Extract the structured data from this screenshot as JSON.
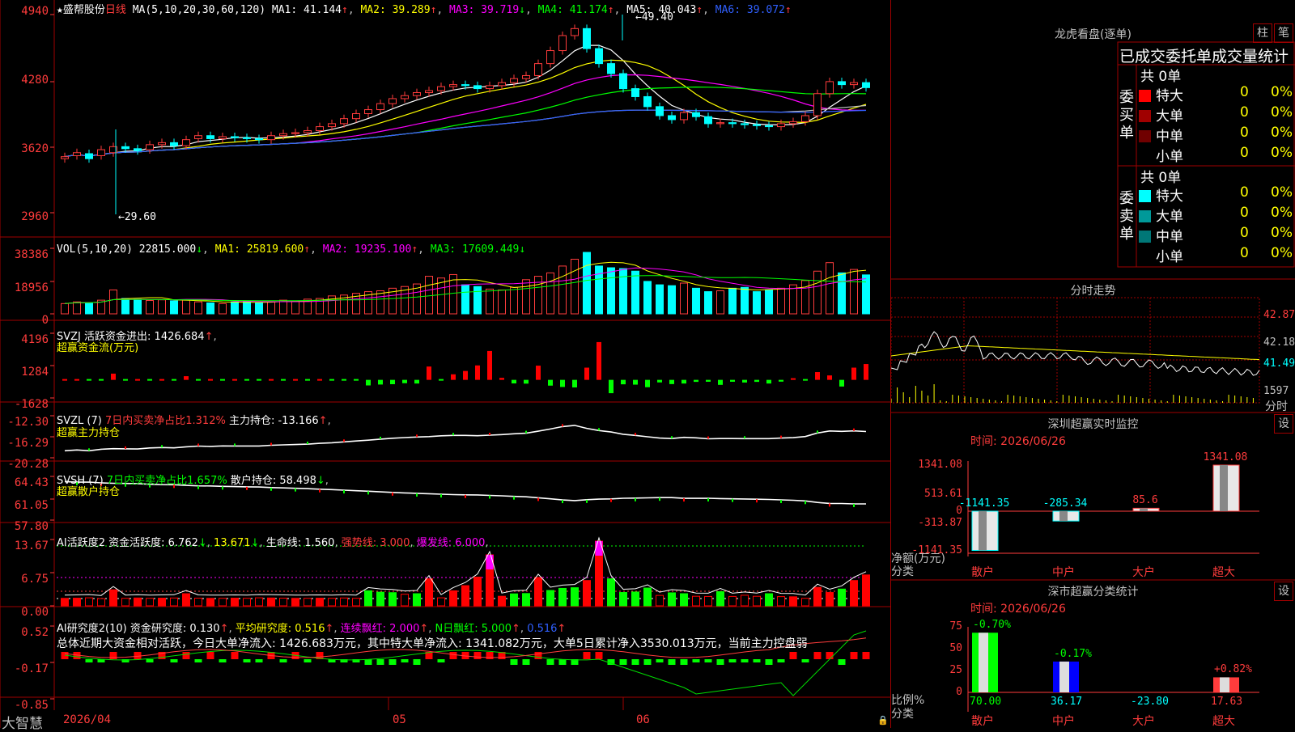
{
  "stock": {
    "name": "盛帮股份",
    "period": "日线",
    "ma_label": "MA(5,10,20,30,60,120)",
    "ma1": "MA1: 41.144",
    "ma2": "MA2: 39.289",
    "ma3": "MA3: 39.719",
    "ma4": "MA4: 41.174",
    "ma5": "MA5: 40.043",
    "ma6": "MA6: 39.072",
    "high_mark": "49.40",
    "low_mark": "29.60",
    "price_axis": [
      "4940",
      "4280",
      "3620",
      "2960"
    ]
  },
  "vol": {
    "label": "VOL(5,10,20)",
    "value": "22815.000",
    "ma1": "MA1: 25819.600",
    "ma2": "MA2: 19235.100",
    "ma3": "MA3: 17609.449",
    "axis": [
      "38386",
      "18956",
      "0"
    ]
  },
  "svzj": {
    "label": "SVZJ",
    "text": "活跃资金进出: 1426.684",
    "sub": "超赢资金流(万元)",
    "axis": [
      "4196",
      "1284",
      "-1628"
    ]
  },
  "svzl": {
    "label": "SVZL (7)",
    "t1": "7日内买卖净占比1.312%",
    "t2": "主力持仓: -13.166",
    "sub": "超赢主力持仓",
    "axis": [
      "-12.30",
      "-16.29",
      "-20.28"
    ]
  },
  "svsh": {
    "label": "SVSH (7)",
    "t1": "7日内买卖净占比1.657%",
    "t2": "散户持仓: 58.498",
    "sub": "超赢散户持仓",
    "axis": [
      "64.43",
      "61.05",
      "57.80"
    ]
  },
  "ai1": {
    "label": "AI活跃度2",
    "t1": "资金活跃度: 6.762",
    "t2": "13.671",
    "t3": "生命线: 1.560",
    "t4": "强势线: 3.000",
    "t5": "爆发线: 6.000",
    "axis": [
      "13.67",
      "6.75",
      "0.00"
    ]
  },
  "ai2": {
    "label": "AI研究度2(10)",
    "t1": "资金研究度: 0.130",
    "t2": "平均研究度: 0.516",
    "t3": "连续飘红: 2.000",
    "t4": "N日飘红: 5.000",
    "t5": "0.516",
    "summary": "总体近期大资金相对活跃，今日大单净流入: 1426.683万元，其中特大单净流入: 1341.082万元，大单5日累计净入3530.013万元，当前主力控盘弱",
    "axis": [
      "0.52",
      "-0.17",
      "-0.85"
    ]
  },
  "dates": [
    "2026/04",
    "05",
    "06"
  ],
  "brand": "大智慧",
  "right": {
    "dragon_title": "龙虎看盘(逐单)",
    "btn_bar": "柱",
    "btn_pen": "笔",
    "stat_title": "已成交委托单成交量统计",
    "buy_label": "委买单",
    "sell_label": "委卖单",
    "buy_total": "共 0单",
    "sell_total": "共 0单",
    "buy_rows": [
      {
        "name": "特大",
        "val": "0",
        "pct": "0%",
        "color": "#ff0000"
      },
      {
        "name": "大单",
        "val": "0",
        "pct": "0%",
        "color": "#a00000"
      },
      {
        "name": "中单",
        "val": "0",
        "pct": "0%",
        "color": "#700000"
      },
      {
        "name": "小单",
        "val": "0",
        "pct": "0%",
        "color": ""
      }
    ],
    "sell_rows": [
      {
        "name": "特大",
        "val": "0",
        "pct": "0%",
        "color": "#00ffff"
      },
      {
        "name": "大单",
        "val": "0",
        "pct": "0%",
        "color": "#009999"
      },
      {
        "name": "中单",
        "val": "0",
        "pct": "0%",
        "color": "#007777"
      },
      {
        "name": "小单",
        "val": "0",
        "pct": "0%",
        "color": ""
      }
    ],
    "intraday_title": "分时走势",
    "intraday_axis": [
      "42.87",
      "42.18",
      "41.49"
    ],
    "intraday_vol": "1597",
    "intraday_footer": "分时",
    "monitor_title": "深圳超赢实时监控",
    "monitor_date": "时间: 2026/06/26",
    "btn_set": "设",
    "monitor_axis": [
      "1341.08",
      "513.61",
      "0",
      "-313.87",
      "-1141.35"
    ],
    "monitor_ylabel": "净额(万元)",
    "monitor_xlabel": "分类",
    "monitor_bars": [
      {
        "cat": "散户",
        "value": -1141.35,
        "label": "-1141.35"
      },
      {
        "cat": "中户",
        "value": -285.34,
        "label": "-285.34"
      },
      {
        "cat": "大户",
        "value": 85.6,
        "label": "85.6"
      },
      {
        "cat": "超大",
        "value": 1341.08,
        "label": "1341.08"
      }
    ],
    "class_title": "深市超赢分类统计",
    "class_date": "时间: 2026/06/26",
    "class_axis": [
      "75",
      "50",
      "25",
      "0"
    ],
    "class_ylabel": "比例%",
    "class_xlabel": "分类",
    "class_bars": [
      {
        "cat": "散户",
        "value": 70.0,
        "label": "70.00",
        "delta": "-0.70%"
      },
      {
        "cat": "中户",
        "value": 36.17,
        "label": "36.17",
        "delta": "-0.17%"
      },
      {
        "cat": "大户",
        "value": -23.8,
        "label": "-23.80",
        "delta": ""
      },
      {
        "cat": "超大",
        "value": 17.63,
        "label": "17.63",
        "delta": "+0.82%"
      }
    ]
  },
  "chart_data": [
    {
      "type": "candlestick",
      "title": "盛帮股份 日线",
      "ylim": [
        29.6,
        49.4
      ],
      "note": "daily candles approx",
      "closes": [
        35.2,
        35.6,
        35.0,
        35.9,
        36.2,
        36.0,
        35.8,
        36.4,
        36.6,
        36.3,
        36.9,
        37.3,
        37.0,
        37.2,
        37.1,
        37.0,
        36.9,
        37.3,
        37.5,
        37.6,
        37.8,
        38.2,
        38.5,
        39.0,
        39.5,
        39.9,
        40.5,
        41.0,
        41.3,
        41.6,
        41.8,
        42.2,
        42.4,
        42.3,
        42.0,
        42.3,
        42.6,
        43.0,
        43.3,
        44.5,
        45.8,
        47.3,
        48.0,
        46.0,
        44.5,
        43.5,
        42.0,
        41.2,
        40.2,
        39.3,
        38.9,
        39.6,
        39.2,
        38.5,
        38.6,
        38.5,
        38.4,
        38.3,
        38.2,
        38.5,
        38.7,
        39.3,
        41.5,
        42.7,
        42.4,
        42.6,
        42.1
      ],
      "opens": [
        35.0,
        35.3,
        35.5,
        35.3,
        35.6,
        36.2,
        36.0,
        35.9,
        36.4,
        36.6,
        36.3,
        37.0,
        37.3,
        37.0,
        37.2,
        37.1,
        37.0,
        36.9,
        37.3,
        37.5,
        37.6,
        37.8,
        38.2,
        38.5,
        39.0,
        39.5,
        39.9,
        40.5,
        41.0,
        41.3,
        41.6,
        41.8,
        42.2,
        42.4,
        42.3,
        42.0,
        42.3,
        42.6,
        43.0,
        43.3,
        44.5,
        45.8,
        47.3,
        48.0,
        46.0,
        44.5,
        43.5,
        42.0,
        41.2,
        40.2,
        39.3,
        38.9,
        39.6,
        39.2,
        38.5,
        38.6,
        38.5,
        38.4,
        38.3,
        38.2,
        38.5,
        38.7,
        39.3,
        41.5,
        42.7,
        42.4,
        42.6
      ]
    },
    {
      "type": "bar",
      "title": "VOL",
      "ylim": [
        0,
        38386
      ],
      "values": [
        6000,
        7000,
        6500,
        8000,
        14000,
        9000,
        8500,
        7800,
        8200,
        7600,
        8000,
        7000,
        6400,
        6000,
        7000,
        7600,
        6500,
        7000,
        8000,
        7500,
        8600,
        9000,
        10500,
        11000,
        12000,
        13000,
        13500,
        15000,
        16000,
        17500,
        22000,
        21000,
        23000,
        17000,
        16000,
        14500,
        14000,
        15500,
        20000,
        22000,
        24000,
        28000,
        32000,
        36000,
        28000,
        27000,
        26500,
        25000,
        19000,
        17000,
        16500,
        18000,
        15000,
        13000,
        13500,
        15000,
        15500,
        13000,
        14000,
        15000,
        17000,
        19500,
        25000,
        30000,
        24000,
        26000,
        22815
      ]
    },
    {
      "type": "bar",
      "title": "SVZJ 活跃资金进出",
      "ylim": [
        -1628,
        4196
      ],
      "values": [
        60,
        70,
        -90,
        -40,
        560,
        -60,
        80,
        -60,
        70,
        -80,
        330,
        -70,
        60,
        -60,
        70,
        -60,
        -90,
        80,
        -70,
        60,
        -60,
        70,
        -60,
        -80,
        -60,
        -500,
        -420,
        -390,
        -300,
        -330,
        1200,
        -90,
        500,
        800,
        1300,
        2600,
        180,
        -320,
        -340,
        1280,
        -520,
        -640,
        -680,
        1100,
        3400,
        -1200,
        -400,
        -430,
        -660,
        -230,
        -380,
        -330,
        -180,
        -170,
        -450,
        -170,
        -240,
        -180,
        -330,
        -160,
        150,
        -60,
        700,
        400,
        -600,
        1100,
        1426
      ]
    }
  ]
}
